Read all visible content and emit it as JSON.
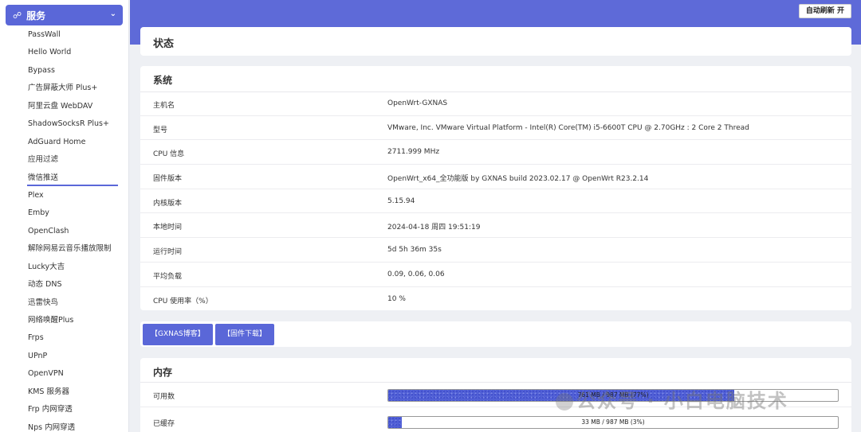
{
  "sidebar": {
    "header_label": "服务",
    "items": [
      {
        "label": "PassWall"
      },
      {
        "label": "Hello World"
      },
      {
        "label": "Bypass"
      },
      {
        "label": "广告屏蔽大师 Plus+"
      },
      {
        "label": "阿里云盘 WebDAV"
      },
      {
        "label": "ShadowSocksR Plus+"
      },
      {
        "label": "AdGuard Home"
      },
      {
        "label": "应用过滤"
      },
      {
        "label": "微信推送"
      },
      {
        "label": "Plex"
      },
      {
        "label": "Emby"
      },
      {
        "label": "OpenClash"
      },
      {
        "label": "解除网易云音乐播放限制"
      },
      {
        "label": "Lucky大吉"
      },
      {
        "label": "动态 DNS"
      },
      {
        "label": "迅雷快鸟"
      },
      {
        "label": "网络唤醒Plus"
      },
      {
        "label": "Frps"
      },
      {
        "label": "UPnP"
      },
      {
        "label": "OpenVPN"
      },
      {
        "label": "KMS 服务器"
      },
      {
        "label": "Frp 内网穿透"
      },
      {
        "label": "Nps 内网穿透"
      }
    ],
    "active_index": 8
  },
  "topbar": {
    "refresh_label": "自动刷新 开"
  },
  "page": {
    "title": "状态"
  },
  "system": {
    "title": "系统",
    "rows": [
      {
        "key": "主机名",
        "value": "OpenWrt-GXNAS"
      },
      {
        "key": "型号",
        "value": "VMware, Inc. VMware Virtual Platform - Intel(R) Core(TM) i5-6600T CPU @ 2.70GHz : 2 Core 2 Thread"
      },
      {
        "key": "CPU 信息",
        "value": "2711.999 MHz"
      },
      {
        "key": "固件版本",
        "value": "OpenWrt_x64_全功能版 by GXNAS build 2023.02.17 @ OpenWrt R23.2.14"
      },
      {
        "key": "内核版本",
        "value": "5.15.94"
      },
      {
        "key": "本地时间",
        "value": "2024-04-18 周四 19:51:19"
      },
      {
        "key": "运行时间",
        "value": "5d 5h 36m 35s"
      },
      {
        "key": "平均负载",
        "value": "0.09, 0.06, 0.06"
      },
      {
        "key": "CPU 使用率（%）",
        "value": "10 %"
      }
    ]
  },
  "links": {
    "blog_label": "【GXNAS博客】",
    "firmware_label": "【固件下载】"
  },
  "memory": {
    "title": "内存",
    "rows": [
      {
        "key": "可用数",
        "bar_text": "761 MB / 987 MB (77%)",
        "fraction": 0.77
      },
      {
        "key": "已缓存",
        "bar_text": "33 MB / 987 MB (3%)",
        "fraction": 0.03
      }
    ]
  },
  "watermark": {
    "text": "公众号 · 小白电脑技术"
  },
  "colors": {
    "accent": "#5a67d8",
    "topbar": "#5e6ad8"
  }
}
